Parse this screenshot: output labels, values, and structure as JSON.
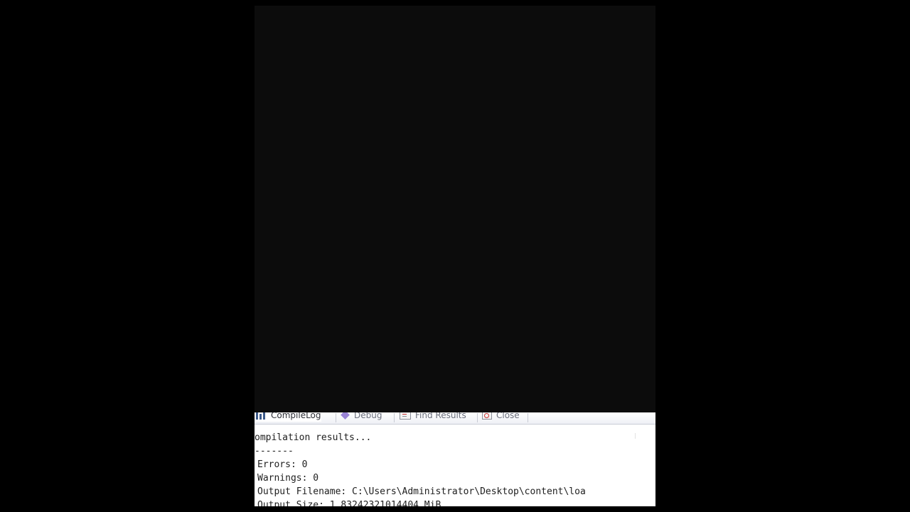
{
  "tabs": [
    {
      "label": "CompileLog",
      "icon": "bar-chart-icon"
    },
    {
      "label": "Debug",
      "icon": "debug-icon"
    },
    {
      "label": "Find Results",
      "icon": "find-results-icon"
    },
    {
      "label": "Close",
      "icon": "close-icon"
    }
  ],
  "output": {
    "lines": [
      "ompilation results...",
      "-------",
      "Errors: 0",
      "Warnings: 0",
      "Output Filename: C:\\Users\\Administrator\\Desktop\\content\\loa",
      "Output Size: 1.83242321014404 MiB"
    ]
  },
  "colors": {
    "page_background": "#000000",
    "video_background": "#0c0c0c",
    "panel_background": "#ffffff",
    "text": "#1e1e1e"
  }
}
